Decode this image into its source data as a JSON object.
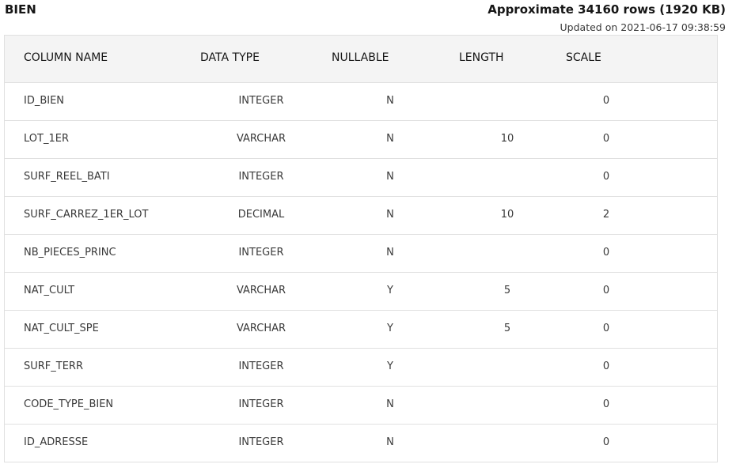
{
  "table": {
    "name": "BIEN",
    "summary": "Approximate 34160 rows (1920 KB)",
    "updated": "Updated on 2021-06-17 09:38:59"
  },
  "columns": {
    "name": "COLUMN NAME",
    "type": "DATA TYPE",
    "nullable": "NULLABLE",
    "length": "LENGTH",
    "scale": "SCALE"
  },
  "rows": [
    {
      "name": "ID_BIEN",
      "type": "INTEGER",
      "nullable": "N",
      "length": "",
      "scale": "0"
    },
    {
      "name": "LOT_1ER",
      "type": "VARCHAR",
      "nullable": "N",
      "length": "10",
      "scale": "0"
    },
    {
      "name": "SURF_REEL_BATI",
      "type": "INTEGER",
      "nullable": "N",
      "length": "",
      "scale": "0"
    },
    {
      "name": "SURF_CARREZ_1ER_LOT",
      "type": "DECIMAL",
      "nullable": "N",
      "length": "10",
      "scale": "2"
    },
    {
      "name": "NB_PIECES_PRINC",
      "type": "INTEGER",
      "nullable": "N",
      "length": "",
      "scale": "0"
    },
    {
      "name": "NAT_CULT",
      "type": "VARCHAR",
      "nullable": "Y",
      "length": "5",
      "scale": "0"
    },
    {
      "name": "NAT_CULT_SPE",
      "type": "VARCHAR",
      "nullable": "Y",
      "length": "5",
      "scale": "0"
    },
    {
      "name": "SURF_TERR",
      "type": "INTEGER",
      "nullable": "Y",
      "length": "",
      "scale": "0"
    },
    {
      "name": "CODE_TYPE_BIEN",
      "type": "INTEGER",
      "nullable": "N",
      "length": "",
      "scale": "0"
    },
    {
      "name": "ID_ADRESSE",
      "type": "INTEGER",
      "nullable": "N",
      "length": "",
      "scale": "0"
    }
  ]
}
